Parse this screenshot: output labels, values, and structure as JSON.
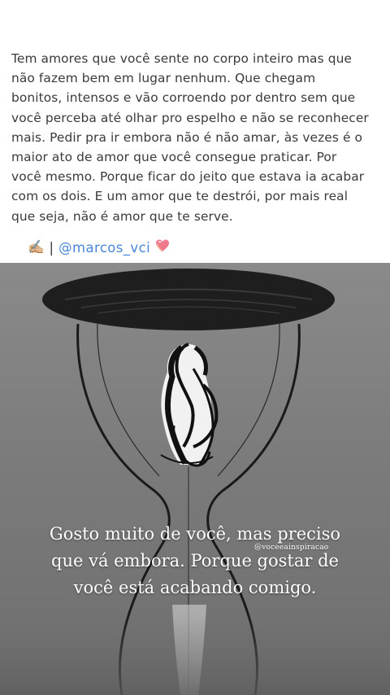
{
  "post": {
    "text_lines": [
      "Tem amores que você sente no corpo inteiro mas que",
      "não fazem bem em lugar nenhum. Que chegam",
      "bonitos, intensos e vão corroendo por dentro sem que",
      "você perceba até olhar pro espelho e não se reconhecer",
      "mais. Pedir pra ir embora não é não amar, às vezes é o",
      "maior ato de amor que você consegue praticar. Por",
      "você mesmo. Porque ficar do jeito que estava ia acabar",
      "com os dois. E um amor que te destrói, por mais real",
      "que seja, não é amor que te serve."
    ],
    "signature": {
      "writing_emoji": "✍🏼",
      "separator": "|",
      "handle": "@marcos_vci",
      "heart_icon": "peach-heart-icon",
      "handle_color": "#4a86d8"
    }
  },
  "image": {
    "subject_icon": "hourglass-woman-illustration",
    "quote_lines": [
      "Gosto muito de você, mas preciso",
      "que vá embora. Porque gostar de",
      "você está acabando comigo."
    ],
    "watermark": "@voceeainspiracao"
  }
}
